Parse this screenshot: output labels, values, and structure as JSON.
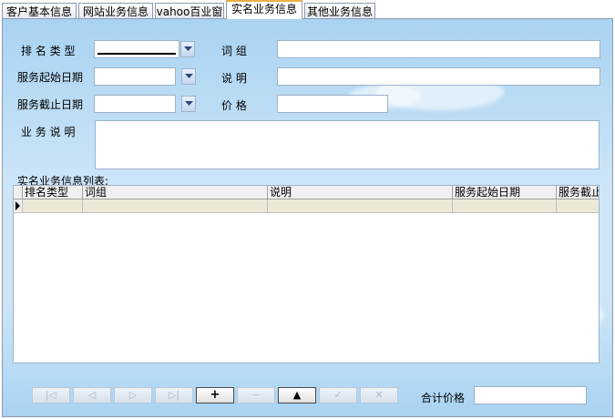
{
  "tabs": [
    {
      "label": "客户基本信息",
      "active": false
    },
    {
      "label": "网站业务信息",
      "active": false
    },
    {
      "label": "vahoo百业窗",
      "active": false
    },
    {
      "label": "实名业务信息",
      "active": true
    },
    {
      "label": "其他业务信息",
      "active": false
    }
  ],
  "form": {
    "rank_type_label": "排 名 类 型",
    "start_date_label": "服务起始日期",
    "end_date_label": "服务截止日期",
    "desc_label": "业 务 说 明",
    "phrase_label": "词     组",
    "explain_label": "说     明",
    "price_label": "价     格"
  },
  "list": {
    "title": "实名业务信息列表:",
    "columns": [
      "排名类型",
      "词组",
      "说明",
      "服务起始日期",
      "服务截止"
    ]
  },
  "toolbar": {
    "buttons": [
      {
        "name": "first",
        "glyph": "|◁",
        "enabled": false
      },
      {
        "name": "prev",
        "glyph": "◁",
        "enabled": false
      },
      {
        "name": "next",
        "glyph": "▷",
        "enabled": false
      },
      {
        "name": "last",
        "glyph": "▷|",
        "enabled": false
      },
      {
        "name": "insert",
        "glyph": "+",
        "enabled": true
      },
      {
        "name": "delete",
        "glyph": "−",
        "enabled": false
      },
      {
        "name": "edit",
        "glyph": "▲",
        "enabled": true
      },
      {
        "name": "post",
        "glyph": "✓",
        "enabled": false
      },
      {
        "name": "cancel",
        "glyph": "✕",
        "enabled": false
      }
    ],
    "total_label": "合计价格"
  }
}
